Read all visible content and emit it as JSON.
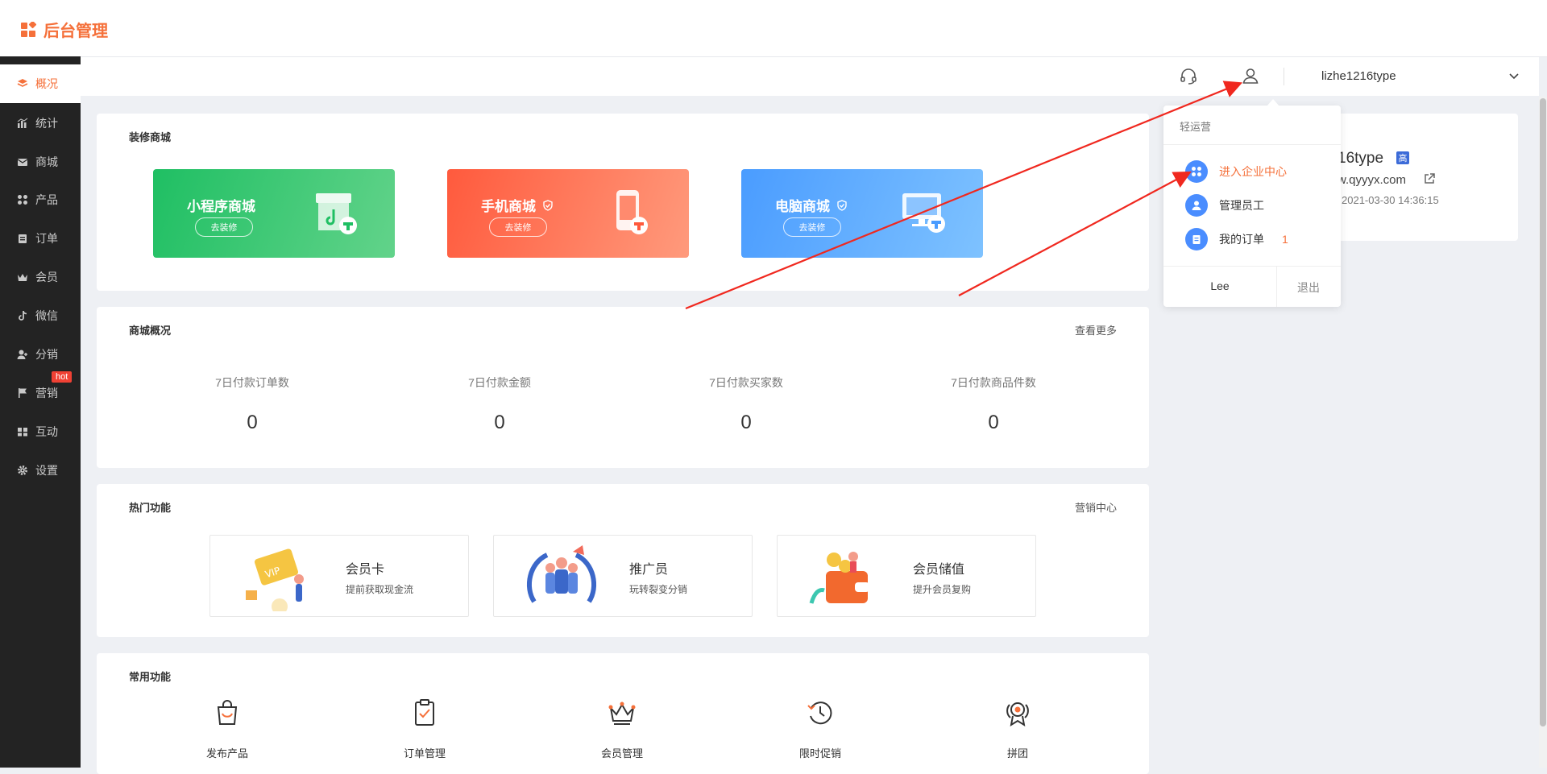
{
  "app": {
    "title": "后台管理"
  },
  "sidebar": {
    "items": [
      {
        "label": "概况",
        "icon": "layers-icon"
      },
      {
        "label": "统计",
        "icon": "chart-icon"
      },
      {
        "label": "商城",
        "icon": "mail-icon"
      },
      {
        "label": "产品",
        "icon": "grid-icon"
      },
      {
        "label": "订单",
        "icon": "clipboard-icon"
      },
      {
        "label": "会员",
        "icon": "crown-icon"
      },
      {
        "label": "微信",
        "icon": "tiktok-icon"
      },
      {
        "label": "分销",
        "icon": "user-add-icon"
      },
      {
        "label": "营销",
        "icon": "flag-icon"
      },
      {
        "label": "互动",
        "icon": "pair-icon"
      },
      {
        "label": "设置",
        "icon": "gear-icon"
      }
    ],
    "hot_badge": "hot"
  },
  "header": {
    "username": "lizhe1216type"
  },
  "decorate": {
    "title": "装修商城",
    "shops": [
      {
        "name": "小程序商城",
        "button": "去装修"
      },
      {
        "name": "手机商城",
        "button": "去装修"
      },
      {
        "name": "电脑商城",
        "button": "去装修"
      }
    ]
  },
  "overview": {
    "title": "商城概况",
    "more": "查看更多",
    "stats": [
      {
        "label": "7日付款订单数",
        "value": "0"
      },
      {
        "label": "7日付款金额",
        "value": "0"
      },
      {
        "label": "7日付款买家数",
        "value": "0"
      },
      {
        "label": "7日付款商品件数",
        "value": "0"
      }
    ]
  },
  "hot_features": {
    "title": "热门功能",
    "more": "营销中心",
    "items": [
      {
        "title": "会员卡",
        "subtitle": "提前获取现金流"
      },
      {
        "title": "推广员",
        "subtitle": "玩转裂变分销"
      },
      {
        "title": "会员储值",
        "subtitle": "提升会员复购"
      }
    ]
  },
  "common": {
    "title": "常用功能",
    "items": [
      {
        "label": "发布产品"
      },
      {
        "label": "订单管理"
      },
      {
        "label": "会员管理"
      },
      {
        "label": "限时促销"
      },
      {
        "label": "拼团"
      }
    ]
  },
  "dropdown": {
    "header": "轻运营",
    "items": [
      {
        "label": "进入企业中心",
        "badge": ""
      },
      {
        "label": "管理员工",
        "badge": ""
      },
      {
        "label": "我的订单",
        "badge": "1"
      }
    ],
    "user": "Lee",
    "logout": "退出"
  },
  "account": {
    "name_fragment": "16type",
    "level_badge": "高",
    "domain_fragment": "w.qyyyx.com",
    "date": "2021-03-30 14:36:15"
  },
  "colors": {
    "accent": "#f5703a",
    "sidebar_bg": "#232323",
    "green": "#1fbf63",
    "red": "#ff5a3d",
    "blue": "#4a9cff"
  }
}
